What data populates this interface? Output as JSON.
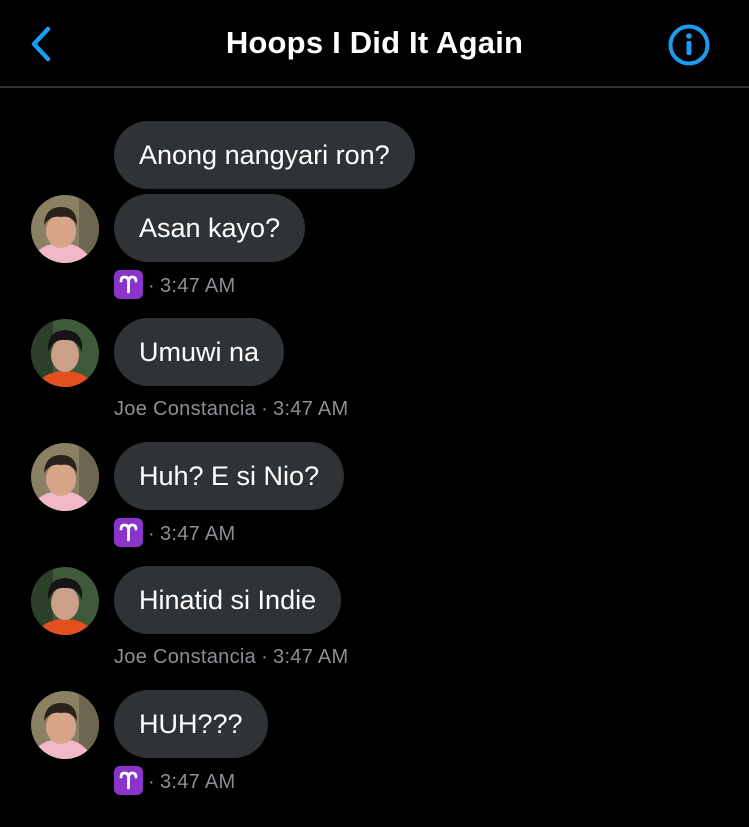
{
  "header": {
    "title": "Hoops I Did It Again",
    "back_icon": "chevron-left-icon",
    "info_icon": "info-icon",
    "accent_color": "#1d9bf0"
  },
  "messages": [
    {
      "sender": "self",
      "text": "Anong nangyari ron?"
    },
    {
      "sender": "self",
      "text": "Asan kayo?"
    },
    {
      "sender": "other",
      "text": "Umuwi na"
    },
    {
      "sender": "self",
      "text": "Huh? E si Nio?"
    },
    {
      "sender": "other",
      "text": "Hinatid si Indie"
    },
    {
      "sender": "self",
      "text": "HUH???"
    }
  ],
  "meta": [
    {
      "name": "",
      "emoji": "aries-icon",
      "separator": "·",
      "time": "3:47 AM"
    },
    {
      "name": "Joe Constancia",
      "separator": "·",
      "time": "3:47 AM"
    },
    {
      "name": "",
      "emoji": "aries-icon",
      "separator": "·",
      "time": "3:47 AM"
    },
    {
      "name": "Joe Constancia",
      "separator": "·",
      "time": "3:47 AM"
    },
    {
      "name": "",
      "emoji": "aries-icon",
      "separator": "·",
      "time": "3:47 AM"
    }
  ],
  "colors": {
    "bubble": "#2f3336",
    "meta_text": "#8b8f94",
    "zodiac_badge": "#8a34c9"
  }
}
